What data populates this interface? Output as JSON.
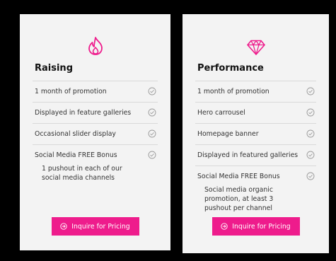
{
  "cards": [
    {
      "icon": "flame-icon",
      "title": "Raising",
      "features": [
        {
          "label": "1 month of promotion"
        },
        {
          "label": "Displayed in feature galleries"
        },
        {
          "label": "Occasional slider display"
        },
        {
          "label": "Social Media FREE Bonus",
          "note": "1 pushout in each of our social media channels"
        }
      ],
      "button_label": "Inquire for Pricing"
    },
    {
      "icon": "diamond-icon",
      "title": "Performance",
      "features": [
        {
          "label": "1 month of promotion"
        },
        {
          "label": "Hero carrousel"
        },
        {
          "label": "Homepage banner"
        },
        {
          "label": "Displayed in featured galleries"
        },
        {
          "label": "Social Media FREE Bonus",
          "note": "Social media organic promotion, at least 3 pushout per channel"
        }
      ],
      "button_label": "Inquire for Pricing"
    }
  ],
  "colors": {
    "accent": "#ee1c8c",
    "card_bg": "#f3f3f3",
    "page_bg": "#000000",
    "check": "#9a9a9a"
  }
}
